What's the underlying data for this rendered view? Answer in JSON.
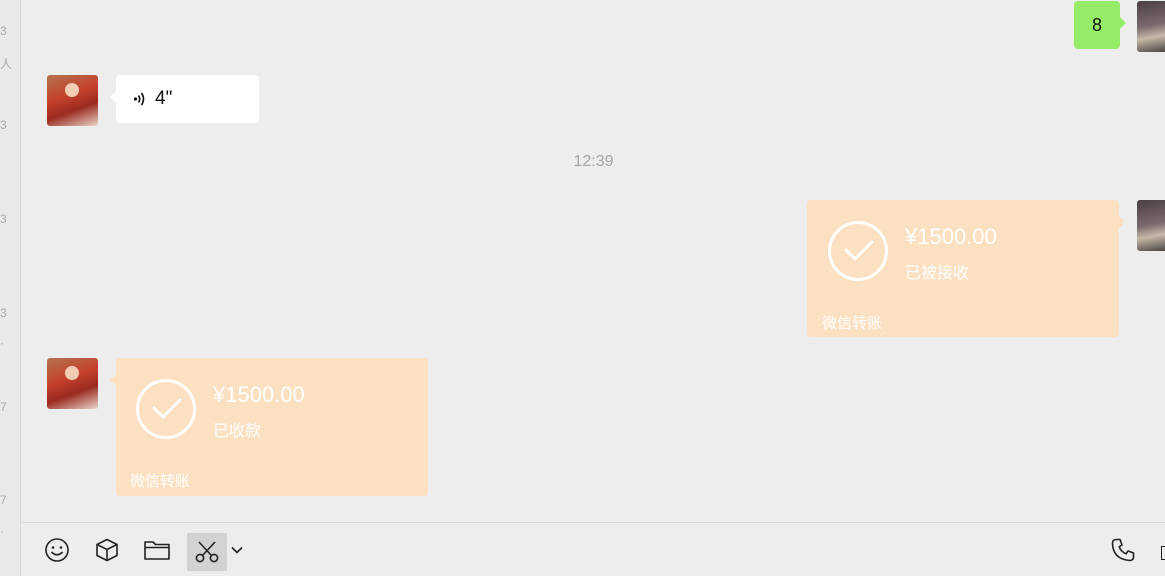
{
  "sidebar_fragments": [
    "3",
    "人",
    "3",
    "3",
    "3",
    "·",
    "7",
    "7",
    "·"
  ],
  "messages": {
    "sent_number": "8",
    "voice_duration": "4\"",
    "timestamp": "12:39",
    "transfer_sent": {
      "amount": "¥1500.00",
      "status": "已被接收",
      "label": "微信转账"
    },
    "transfer_received": {
      "amount": "¥1500.00",
      "status": "已收款",
      "label": "微信转账"
    }
  },
  "toolbar": {
    "icons": [
      "emoji-icon",
      "box-icon",
      "folder-icon",
      "scissors-icon",
      "chevron-down-icon",
      "phone-icon"
    ]
  },
  "colors": {
    "chat_background": "#ededed",
    "sent_bubble": "#95ec69",
    "received_bubble": "#ffffff",
    "transfer_bubble": "#fce0c2"
  }
}
